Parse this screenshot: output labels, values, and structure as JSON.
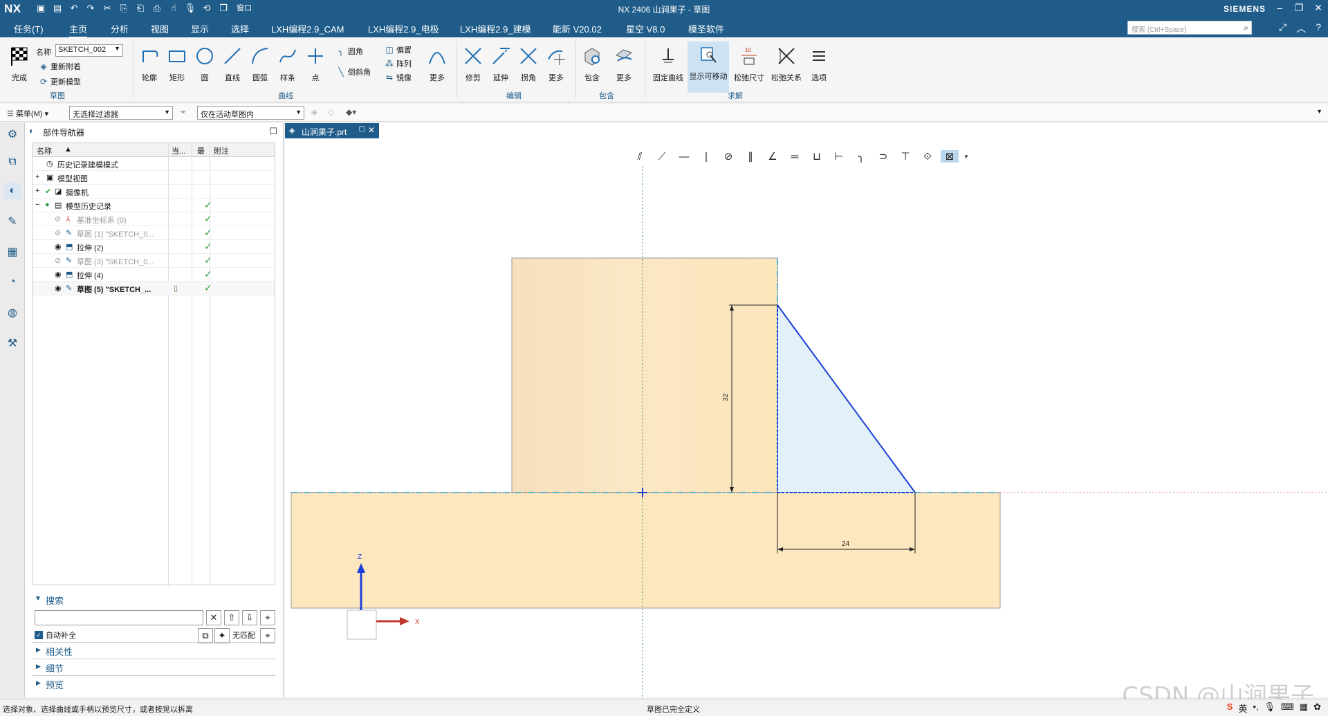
{
  "titlebar": {
    "logo": "NX",
    "title": "NX 2406 山涧果子 - 草图",
    "brand": "SIEMENS",
    "window_menu": "窗口"
  },
  "tabs": [
    "任务(T)",
    "主页",
    "分析",
    "视图",
    "显示",
    "选择",
    "LXH编程2.9_CAM",
    "LXH编程2.9_电极",
    "LXH编程2.9_建模",
    "能新 V20.02",
    "星空 V8.0",
    "模圣软件"
  ],
  "search_placeholder": "搜索 (Ctrl+Space)",
  "ribbon": {
    "sketch_group": {
      "finish": "完成",
      "name_label": "名称",
      "name_value": "SKETCH_002",
      "reattach": "重新附着",
      "update_model": "更新模型",
      "group_label": "草图"
    },
    "curve_group": {
      "profile": "轮廓",
      "rectangle": "矩形",
      "circle": "圆",
      "line": "直线",
      "arc": "圆弧",
      "spline": "样条",
      "point": "点",
      "fillet": "圆角",
      "chamfer": "倒斜角",
      "offset": "偏置",
      "pattern": "阵列",
      "mirror": "镜像",
      "more": "更多",
      "group_label": "曲线"
    },
    "edit_group": {
      "trim": "修剪",
      "extend": "延伸",
      "corner": "拐角",
      "more": "更多",
      "group_label": "编辑"
    },
    "include_group": {
      "include": "包含",
      "more": "更多",
      "group_label": "包含"
    },
    "solve_group": {
      "fix_curve": "固定曲线",
      "show_movable": "显示可移动",
      "relax_dim": "松弛尺寸",
      "relax_rel": "松弛关系",
      "options": "选项",
      "group_label": "求解"
    }
  },
  "selbar": {
    "menu": "菜单(M)",
    "filter": "无选择过滤器",
    "scope": "仅在活动草图内"
  },
  "navigator": {
    "title": "部件导航器",
    "columns": [
      "名称",
      "当...",
      "最",
      "附注"
    ],
    "rows": [
      {
        "label": "历史记录建模模式",
        "style": "normal",
        "check": false
      },
      {
        "label": "模型视图",
        "style": "normal",
        "check": false
      },
      {
        "label": "摄像机",
        "style": "normal",
        "check": false
      },
      {
        "label": "模型历史记录",
        "style": "normal",
        "check": true
      },
      {
        "label": "基准坐标系 (0)",
        "style": "grey",
        "check": true
      },
      {
        "label": "草图 (1) \"SKETCH_0...",
        "style": "grey",
        "check": true
      },
      {
        "label": "拉伸 (2)",
        "style": "normal",
        "check": true
      },
      {
        "label": "草图 (3) \"SKETCH_0...",
        "style": "grey",
        "check": true
      },
      {
        "label": "拉伸 (4)",
        "style": "normal",
        "check": true
      },
      {
        "label": "草图 (5) \"SKETCH_...",
        "style": "bold",
        "check": true
      }
    ],
    "search_title": "搜索",
    "autofill": "自动补全",
    "no_match": "无匹配",
    "panels": [
      "相关性",
      "细节",
      "预览"
    ]
  },
  "graphics": {
    "doc_tab": "山涧果子.prt",
    "dim_vertical": "32",
    "dim_horizontal": "24",
    "axis_z": "Z",
    "axis_x": "X"
  },
  "status": {
    "left": "选择对象、选择曲线或手柄以预览尺寸，或者按晃以拆离",
    "middle": "草图已完全定义",
    "ime": "英"
  },
  "watermark": "CSDN @山涧果子",
  "colors": {
    "brand_blue": "#1f5c8a",
    "solid_fill": "#fbe5bb",
    "sketch_line": "#1a3fd6",
    "triangle_fill": "#e2f0f7"
  }
}
